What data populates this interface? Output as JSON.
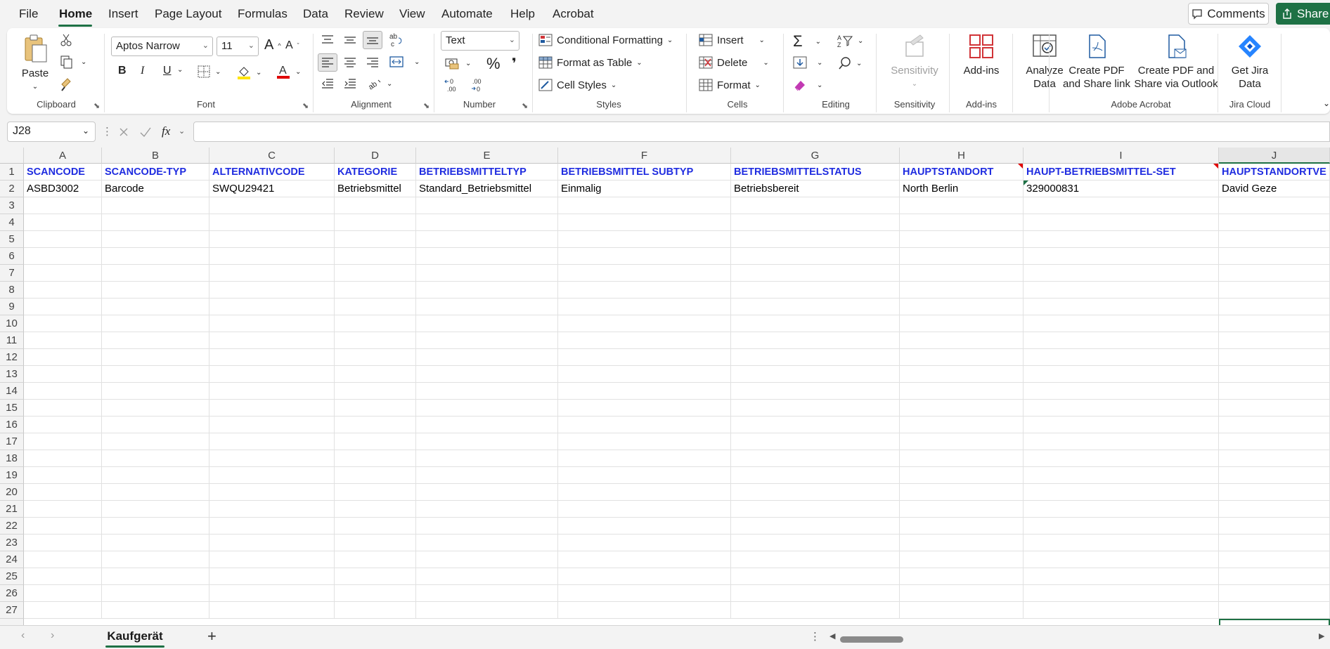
{
  "menu": {
    "items": [
      "File",
      "Home",
      "Insert",
      "Page Layout",
      "Formulas",
      "Data",
      "Review",
      "View",
      "Automate",
      "Help",
      "Acrobat"
    ],
    "comments_label": "Comments",
    "share_label": "Share"
  },
  "ribbon": {
    "clipboard": {
      "paste": "Paste",
      "label": "Clipboard"
    },
    "font": {
      "family": "Aptos Narrow",
      "size": "11",
      "bold": "B",
      "italic": "I",
      "underline": "U",
      "label": "Font"
    },
    "alignment": {
      "label": "Alignment"
    },
    "number": {
      "format": "Text",
      "percent": "%",
      "comma": "❜",
      "inc_dec": "←0 .00",
      "dec_dec": ".00 →0",
      "label": "Number"
    },
    "styles": {
      "conditional": "Conditional Formatting",
      "format_table": "Format as Table",
      "cell_styles": "Cell Styles",
      "label": "Styles"
    },
    "cells": {
      "insert": "Insert",
      "delete": "Delete",
      "format": "Format",
      "label": "Cells"
    },
    "editing": {
      "label": "Editing"
    },
    "sensitivity": {
      "button": "Sensitivity",
      "label": "Sensitivity"
    },
    "addins": {
      "button": "Add-ins",
      "label": "Add-ins"
    },
    "analyze": {
      "line1": "Analyze",
      "line2": "Data"
    },
    "acrobat": {
      "pdf_link_1": "Create PDF",
      "pdf_link_2": "and Share link",
      "pdf_outlook_1": "Create PDF and",
      "pdf_outlook_2": "Share via Outlook",
      "label": "Adobe Acrobat"
    },
    "jira": {
      "line1": "Get Jira",
      "line2": "Data",
      "label": "Jira Cloud"
    }
  },
  "formula_bar": {
    "name_box": "J28",
    "fx": "fx",
    "content": ""
  },
  "sheet": {
    "columns": [
      "A",
      "B",
      "C",
      "D",
      "E",
      "F",
      "G",
      "H",
      "I",
      "J"
    ],
    "row_numbers": [
      "1",
      "2",
      "3",
      "4",
      "5",
      "6",
      "7",
      "8",
      "9",
      "10",
      "11",
      "12",
      "13",
      "14",
      "15",
      "16",
      "17",
      "18",
      "19",
      "20",
      "21",
      "22",
      "23",
      "24",
      "25",
      "26",
      "27"
    ],
    "header_row": [
      "SCANCODE",
      "SCANCODE-TYP",
      "ALTERNATIVCODE",
      "KATEGORIE",
      "BETRIEBSMITTELTYP",
      "BETRIEBSMITTEL SUBTYP",
      "BETRIEBSMITTELSTATUS",
      "HAUPTSTANDORT",
      "HAUPT-BETRIEBSMITTEL-SET",
      "HAUPTSTANDORTVE"
    ],
    "data_row": [
      "ASBD3002",
      "Barcode",
      "SWQU29421",
      "Betriebsmittel",
      "Standard_Betriebsmittel",
      "Einmalig",
      "Betriebsbereit",
      "North Berlin",
      "329000831",
      "David Geze"
    ]
  },
  "tabs": {
    "active": "Kaufgerät",
    "add": "+"
  },
  "colors": {
    "accent": "#1e7145",
    "header_text": "#1f2ce0"
  }
}
